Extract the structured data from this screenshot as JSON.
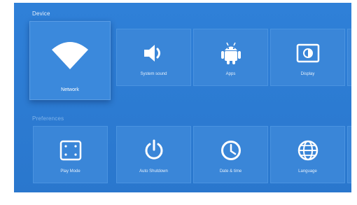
{
  "sections": {
    "device": {
      "title": "Device",
      "items": [
        {
          "label": "Network",
          "icon": "wifi-icon"
        },
        {
          "label": "System sound",
          "icon": "volume-icon"
        },
        {
          "label": "Apps",
          "icon": "android-icon"
        },
        {
          "label": "Display",
          "icon": "display-icon"
        }
      ]
    },
    "preferences": {
      "title": "Preferences",
      "items": [
        {
          "label": "Play Mode",
          "icon": "play-mode-icon"
        },
        {
          "label": "Auto Shutdown",
          "icon": "power-icon"
        },
        {
          "label": "Date & time",
          "icon": "clock-icon"
        },
        {
          "label": "Language",
          "icon": "globe-icon"
        }
      ]
    }
  },
  "colors": {
    "background": "#2e7dd4",
    "tile": "#3a86d8",
    "icon": "#ffffff"
  }
}
